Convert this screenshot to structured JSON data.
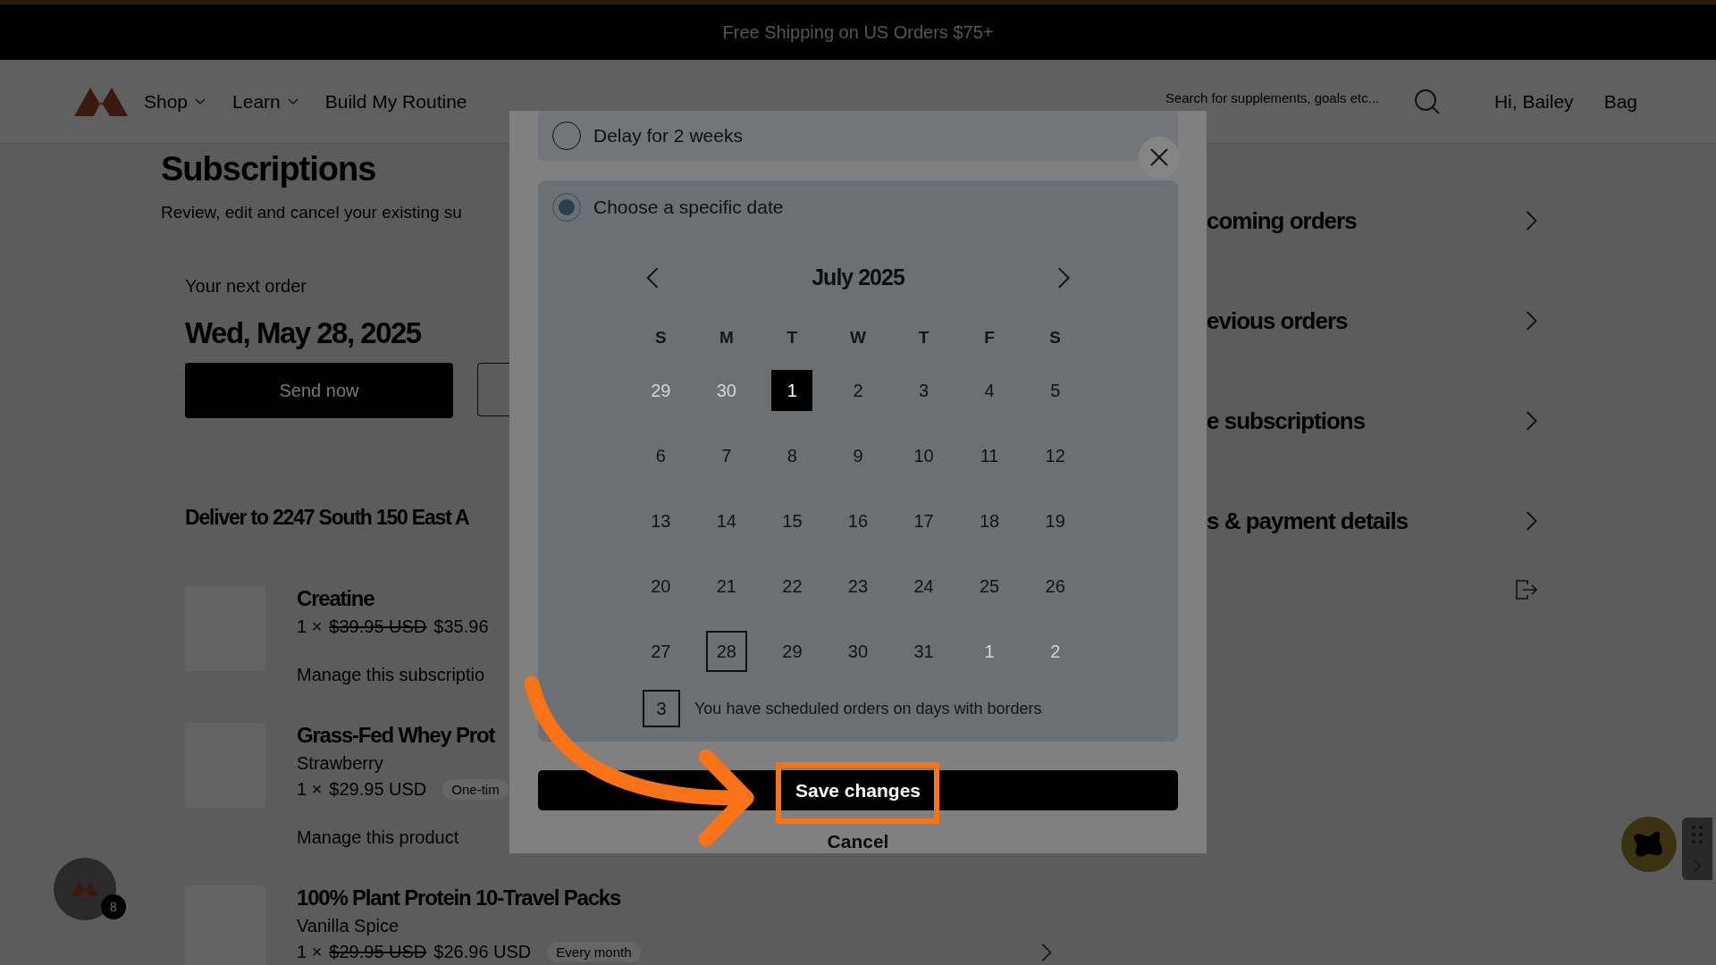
{
  "announcement": "Free Shipping on US Orders $75+",
  "nav": {
    "links": [
      {
        "label": "Shop",
        "dropdown": true
      },
      {
        "label": "Learn",
        "dropdown": true
      },
      {
        "label": "Build My Routine",
        "dropdown": false
      }
    ],
    "search": {
      "placeholder": "Search for supplements, goals etc..."
    },
    "greeting": "Hi, Bailey",
    "bag": "Bag"
  },
  "page": {
    "title": "Subscriptions",
    "subtitle": "Review, edit and cancel your existing su"
  },
  "next_order": {
    "label": "Your next order",
    "date": "Wed, May 28, 2025",
    "send_button": "Send now"
  },
  "delivery": {
    "heading": "Deliver to 2247 South 150 East A",
    "products": [
      {
        "name": "Creatine",
        "quantity": "1 ×",
        "old_price": "$39.95 USD",
        "price": "$35.96",
        "link": "Manage this subscriptio",
        "chevron": false
      },
      {
        "name": "Grass-Fed Whey Prot",
        "variant": "Strawberry",
        "quantity": "1 ×",
        "price": "$29.95 USD",
        "badge": "One-tim",
        "link": "Manage this product",
        "chevron": false
      },
      {
        "name": "100% Plant Protein 10-Travel Packs",
        "variant": "Vanilla Spice",
        "quantity": "1 ×",
        "old_price": "$29.95 USD",
        "price": "$26.96 USD",
        "badge": "Every month",
        "chevron": true
      }
    ]
  },
  "account_menu": [
    {
      "label": "coming orders"
    },
    {
      "label": "evious orders"
    },
    {
      "label": "e subscriptions"
    },
    {
      "label": "s & payment details"
    }
  ],
  "modal": {
    "options": [
      {
        "label": "Delay for 2 weeks",
        "selected": false
      },
      {
        "label": "Choose a specific date",
        "selected": true
      }
    ],
    "calendar": {
      "month": "July 2025",
      "weekdays": [
        "S",
        "M",
        "T",
        "W",
        "T",
        "F",
        "S"
      ],
      "weeks": [
        [
          {
            "label": "29",
            "outside": true,
            "selected": false,
            "scheduled": false
          },
          {
            "label": "30",
            "outside": true,
            "selected": false,
            "scheduled": false
          },
          {
            "label": "1",
            "outside": false,
            "selected": true,
            "scheduled": false
          },
          {
            "label": "2",
            "outside": false,
            "selected": false,
            "scheduled": false
          },
          {
            "label": "3",
            "outside": false,
            "selected": false,
            "scheduled": false
          },
          {
            "label": "4",
            "outside": false,
            "selected": false,
            "scheduled": false
          },
          {
            "label": "5",
            "outside": false,
            "selected": false,
            "scheduled": false
          }
        ],
        [
          {
            "label": "6",
            "outside": false,
            "selected": false,
            "scheduled": false
          },
          {
            "label": "7",
            "outside": false,
            "selected": false,
            "scheduled": false
          },
          {
            "label": "8",
            "outside": false,
            "selected": false,
            "scheduled": false
          },
          {
            "label": "9",
            "outside": false,
            "selected": false,
            "scheduled": false
          },
          {
            "label": "10",
            "outside": false,
            "selected": false,
            "scheduled": false
          },
          {
            "label": "11",
            "outside": false,
            "selected": false,
            "scheduled": false
          },
          {
            "label": "12",
            "outside": false,
            "selected": false,
            "scheduled": false
          }
        ],
        [
          {
            "label": "13",
            "outside": false,
            "selected": false,
            "scheduled": false
          },
          {
            "label": "14",
            "outside": false,
            "selected": false,
            "scheduled": false
          },
          {
            "label": "15",
            "outside": false,
            "selected": false,
            "scheduled": false
          },
          {
            "label": "16",
            "outside": false,
            "selected": false,
            "scheduled": false
          },
          {
            "label": "17",
            "outside": false,
            "selected": false,
            "scheduled": false
          },
          {
            "label": "18",
            "outside": false,
            "selected": false,
            "scheduled": false
          },
          {
            "label": "19",
            "outside": false,
            "selected": false,
            "scheduled": false
          }
        ],
        [
          {
            "label": "20",
            "outside": false,
            "selected": false,
            "scheduled": false
          },
          {
            "label": "21",
            "outside": false,
            "selected": false,
            "scheduled": false
          },
          {
            "label": "22",
            "outside": false,
            "selected": false,
            "scheduled": false
          },
          {
            "label": "23",
            "outside": false,
            "selected": false,
            "scheduled": false
          },
          {
            "label": "24",
            "outside": false,
            "selected": false,
            "scheduled": false
          },
          {
            "label": "25",
            "outside": false,
            "selected": false,
            "scheduled": false
          },
          {
            "label": "26",
            "outside": false,
            "selected": false,
            "scheduled": false
          }
        ],
        [
          {
            "label": "27",
            "outside": false,
            "selected": false,
            "scheduled": false
          },
          {
            "label": "28",
            "outside": false,
            "selected": false,
            "scheduled": true
          },
          {
            "label": "29",
            "outside": false,
            "selected": false,
            "scheduled": false
          },
          {
            "label": "30",
            "outside": false,
            "selected": false,
            "scheduled": false
          },
          {
            "label": "31",
            "outside": false,
            "selected": false,
            "scheduled": false
          },
          {
            "label": "1",
            "outside": true,
            "selected": false,
            "scheduled": false
          },
          {
            "label": "2",
            "outside": true,
            "selected": false,
            "scheduled": false
          }
        ]
      ]
    },
    "legend": {
      "sample": "3",
      "text": "You have scheduled orders on days with borders"
    },
    "save_button": "Save changes",
    "cancel": "Cancel"
  },
  "chat_badge": "8"
}
